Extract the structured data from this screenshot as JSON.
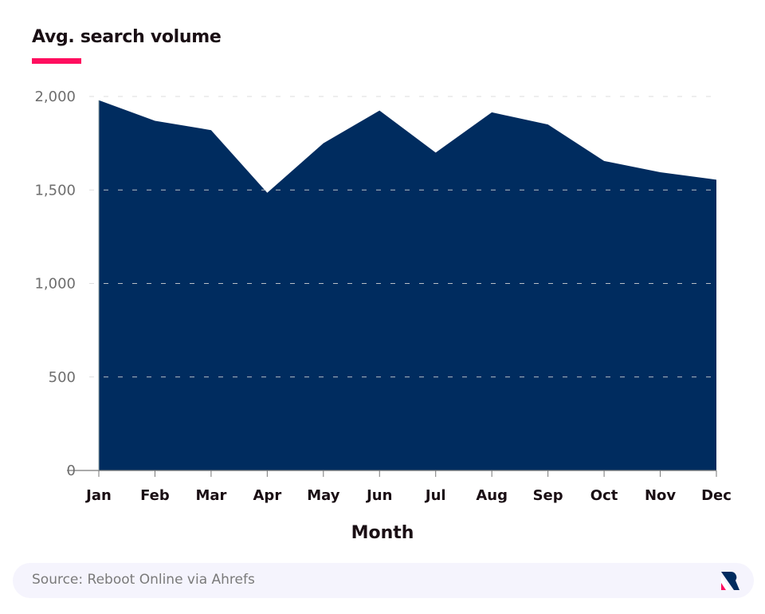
{
  "header": {
    "title": "Avg. search volume",
    "accent_color": "#ff0e5f"
  },
  "footer": {
    "source": "Source: Reboot Online via Ahrefs",
    "logo_icon": "reboot-online-logo"
  },
  "chart_data": {
    "type": "area",
    "title": "Avg. search volume",
    "xlabel": "Month",
    "ylabel": "",
    "categories": [
      "Jan",
      "Feb",
      "Mar",
      "Apr",
      "May",
      "Jun",
      "Jul",
      "Aug",
      "Sep",
      "Oct",
      "Nov",
      "Dec"
    ],
    "series": [
      {
        "name": "Avg. search volume",
        "color": "#002c5f",
        "values": [
          1980,
          1870,
          1820,
          1485,
          1750,
          1925,
          1700,
          1915,
          1850,
          1655,
          1595,
          1555
        ]
      }
    ],
    "ylim": [
      0,
      2000
    ],
    "yticks": [
      0,
      500,
      1000,
      1500,
      2000
    ],
    "ytick_labels": [
      "0",
      "500",
      "1,000",
      "1,500",
      "2,000"
    ],
    "grid": true,
    "legend": "none"
  }
}
